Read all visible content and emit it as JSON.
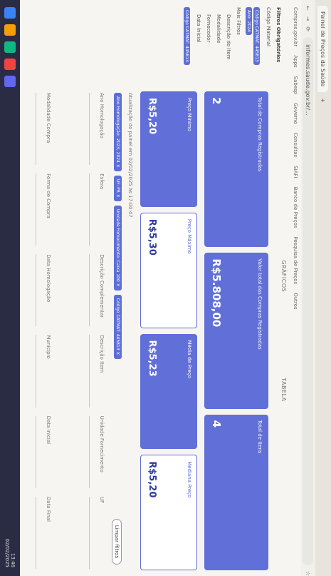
{
  "browser": {
    "tab_title": "Painel de Preços da Saúde",
    "url": "informes.saude.gov.br/...",
    "bookmarks": [
      "Compras.gov.br",
      "Apps",
      "Sabesp",
      "Governo",
      "Consultas",
      "SIAFI",
      "Banco de Preços",
      "Pesquisa de Preços",
      "Outros"
    ]
  },
  "filters": {
    "title": "Filtros Obrigatórios",
    "items": [
      {
        "label": "Código Material",
        "indent": false
      },
      {
        "label": "Mais Filtros",
        "indent": false
      },
      {
        "label": "Descrição do Item",
        "indent": true
      },
      {
        "label": "Modalidade",
        "indent": true
      },
      {
        "label": "Fornecedor",
        "indent": true
      },
      {
        "label": "Data Inicial",
        "indent": true
      }
    ],
    "pills": [
      "Código CATMAT: 445813",
      "Ano: 2024",
      "Código CATMAT: 445813"
    ]
  },
  "tabs": {
    "top": [
      "GRÁFICOS",
      "TABELA"
    ]
  },
  "cards_top": [
    {
      "label": "Total de Compras Registradas",
      "value": "2"
    },
    {
      "label": "Valor total das Compras Registradas",
      "value": "R$5.808,00"
    },
    {
      "label": "Total de Itens",
      "value": "4"
    }
  ],
  "cards_bottom": [
    {
      "label": "Preço Mínimo",
      "value": "R$5,20",
      "highlight": true
    },
    {
      "label": "Preço Máximo",
      "value": "R$5,30",
      "highlight": false
    },
    {
      "label": "Média de Preço",
      "value": "R$5,23",
      "highlight": true
    },
    {
      "label": "Mediana Preço",
      "value": "R$5,20",
      "highlight": false
    }
  ],
  "updated_text": "Atualização do painel em 02/02/2025 às 17:00:47",
  "applied_filters": [
    "Ano Homologação: 2023, 2024 ✕",
    "UF: PR ✕",
    "Unidade Fornecimento: Caixa 100 ✕",
    "Código CATMAT: 445813 ✕"
  ],
  "clear_button": "Limpar filtros",
  "grid_fields": [
    "Ano Homologação",
    "Esfera",
    "Descrição Complementar",
    "Descrição Item",
    "Unidade Fornecimento",
    "UF",
    "Modalidade Compra",
    "Forma de Compra",
    "Data Homologação",
    "Município",
    "Data Inicial",
    "Data Final"
  ],
  "taskbar": {
    "time": "13:46",
    "date": "02/02/2025"
  }
}
